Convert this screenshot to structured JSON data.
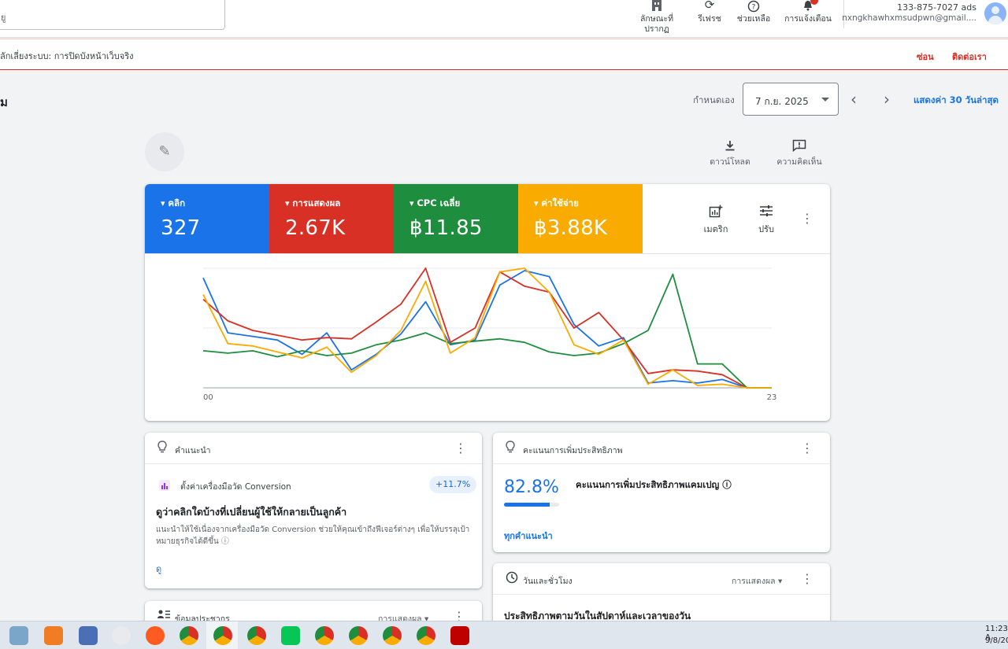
{
  "search": {
    "text": "ยู"
  },
  "top_tools": [
    {
      "icon": "building-icon",
      "label": "ลักษณะที่ปรากฏ"
    },
    {
      "icon": "refresh-icon",
      "label": "รีเฟรช"
    },
    {
      "icon": "help-icon",
      "label": "ช่วยเหลือ"
    },
    {
      "icon": "bell-icon",
      "label": "การแจ้งเตือน"
    }
  ],
  "account": {
    "id": "133-875-7027 ads",
    "email": "nxngkhawhxmsudpwn@gmail...."
  },
  "alert": {
    "text": "ลักเลี่ยงระบบ: การปิดบังหน้าเว็บจริง",
    "hide": "ซ่อน",
    "contact": "ติดต่อเรา"
  },
  "page": {
    "title": "ม"
  },
  "date": {
    "label": "กำหนดเอง",
    "value": "7 ก.ย. 2025",
    "last30": "แสดงค่า 30 วันล่าสุด"
  },
  "actions": {
    "download": "ดาวน์โหลด",
    "feedback": "ความคิดเห็น"
  },
  "metrics": [
    {
      "label": "คลิก",
      "value": "327",
      "color": "#1a73e8"
    },
    {
      "label": "การแสดงผล",
      "value": "2.67K",
      "color": "#d93025"
    },
    {
      "label": "CPC เฉลี่ย",
      "value": "฿11.85",
      "color": "#1e8e3e"
    },
    {
      "label": "ค่าใช้จ่าย",
      "value": "฿3.88K",
      "color": "#f9ab00"
    }
  ],
  "card_tools": {
    "metrics": "เมตริก",
    "adjust": "ปรับ"
  },
  "chart_data": {
    "type": "line",
    "x": [
      "00",
      "01",
      "02",
      "03",
      "04",
      "05",
      "06",
      "07",
      "08",
      "09",
      "10",
      "11",
      "12",
      "13",
      "14",
      "15",
      "16",
      "17",
      "18",
      "19",
      "20",
      "21",
      "22",
      "23"
    ],
    "xticks": [
      "00",
      "23"
    ],
    "series": [
      {
        "color": "#1a73e8",
        "values": [
          92,
          46,
          43,
          40,
          28,
          46,
          15,
          28,
          45,
          72,
          36,
          40,
          86,
          98,
          93,
          53,
          35,
          42,
          4,
          6,
          4,
          7,
          0,
          0
        ]
      },
      {
        "color": "#d93025",
        "values": [
          74,
          56,
          48,
          44,
          40,
          42,
          41,
          55,
          70,
          100,
          38,
          50,
          97,
          85,
          80,
          50,
          63,
          40,
          12,
          15,
          14,
          11,
          0,
          0
        ]
      },
      {
        "color": "#1e8e3e",
        "values": [
          31,
          29,
          31,
          26,
          31,
          27,
          29,
          36,
          40,
          46,
          37,
          39,
          41,
          38,
          30,
          27,
          29,
          37,
          48,
          95,
          20,
          20,
          0,
          0
        ]
      },
      {
        "color": "#f9ab00",
        "values": [
          78,
          37,
          35,
          30,
          25,
          34,
          13,
          27,
          48,
          89,
          29,
          42,
          97,
          100,
          80,
          36,
          28,
          40,
          3,
          15,
          2,
          3,
          0,
          0
        ]
      }
    ],
    "ylim": [
      0,
      100
    ],
    "grid": true
  },
  "recommendation": {
    "title": "คำแนะนำ",
    "sub": "ตั้งค่าเครื่องมือวัด Conversion",
    "badge": "+11.7%",
    "heading": "ดูว่าคลิกใดบ้างที่เปลี่ยนผู้ใช้ให้กลายเป็นลูกค้า",
    "desc": "แนะนำให้ใช้เนื่องจากเครื่องมือวัด Conversion ช่วยให้คุณเข้าถึงฟีเจอร์ต่างๆ เพื่อให้บรรลุเป้าหมายธุรกิจได้ดีขึ้น ⓘ",
    "link": "ดู"
  },
  "optimization": {
    "title": "คะแนนการเพิ่มประสิทธิภาพ",
    "score": "82.8%",
    "score_fraction": 0.828,
    "label": "คะแนนการเพิ่มประสิทธิภาพแคมเปญ ⓘ",
    "link": "ทุกคำแนะนำ"
  },
  "day_time": {
    "title": "วันและชั่วโมง",
    "dropdown": "การแสดงผล ▾",
    "sub": "ประสิทธิภาพตามวันในสัปดาห์และเวลาของวัน"
  },
  "demographics": {
    "title": "ข้อมูลประชากร",
    "dropdown": "การแสดงผล ▾"
  },
  "taskbar": {
    "time": "11:23 A",
    "date": "9/8/20"
  }
}
